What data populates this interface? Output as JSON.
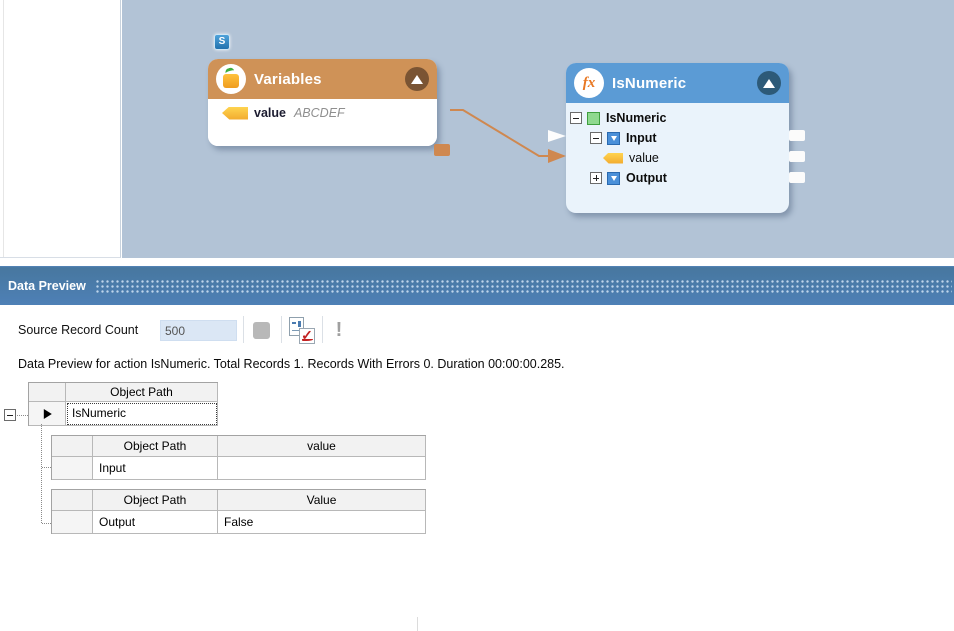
{
  "canvas": {
    "background": "#b2c3d6",
    "start_badge_label": "S",
    "variables_node": {
      "title": "Variables",
      "header_color": "#cf9257",
      "field": {
        "name": "value",
        "value": "ABCDEF"
      }
    },
    "isnumeric_node": {
      "title": "IsNumeric",
      "header_color": "#5b9bd5",
      "fx_glyph": "fx",
      "tree": [
        {
          "label": "IsNumeric"
        },
        {
          "label": "Input"
        },
        {
          "label": "value"
        },
        {
          "label": "Output"
        }
      ]
    },
    "connector_color": "#cf8850"
  },
  "preview": {
    "panel_title": "Data Preview",
    "toolbar": {
      "source_record_count_label": "Source Record Count",
      "source_record_count_value": "500"
    },
    "status_text": "Data Preview for action IsNumeric. Total Records 1. Records With Errors 0. Duration 00:00:00.285.",
    "root_table": {
      "object_path_header": "Object Path",
      "row_value": "IsNumeric"
    },
    "input_table": {
      "object_path_header": "Object Path",
      "value_header": "value",
      "row_path": "Input",
      "row_value": ""
    },
    "output_table": {
      "object_path_header": "Object Path",
      "value_header": "Value",
      "row_path": "Output",
      "row_value": "False"
    }
  },
  "icons": {
    "exclamation": "!",
    "check": "✓"
  }
}
